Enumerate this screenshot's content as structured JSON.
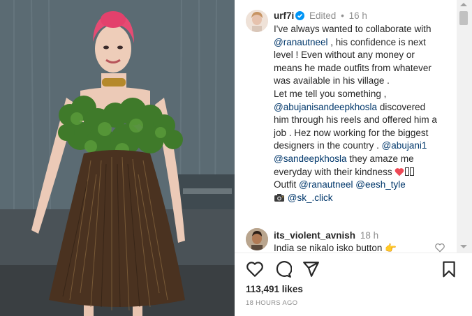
{
  "post": {
    "username": "urf7i",
    "edited_label": "Edited",
    "separator": "•",
    "time": "16 h",
    "caption_lines": [
      [
        {
          "t": "I've always wanted to collaborate with",
          "m": false
        }
      ],
      [
        {
          "t": "@ranautneel",
          "m": true
        },
        {
          "t": " , his confidence is next",
          "m": false
        }
      ],
      [
        {
          "t": "level ! Even without any money or",
          "m": false
        }
      ],
      [
        {
          "t": "means he made outfits from whatever",
          "m": false
        }
      ],
      [
        {
          "t": "was available in his village .",
          "m": false
        }
      ],
      [
        {
          "t": "Let me tell you something ,",
          "m": false
        }
      ],
      [
        {
          "t": "@abujanisandeepkhosla",
          "m": true
        },
        {
          "t": " discovered",
          "m": false
        }
      ],
      [
        {
          "t": "him through his reels and offered him a",
          "m": false
        }
      ],
      [
        {
          "t": "job . Hez now working for the biggest",
          "m": false
        }
      ],
      [
        {
          "t": "designers in the country . ",
          "m": false
        },
        {
          "t": "@abujani1",
          "m": true
        }
      ],
      [
        {
          "t": "@sandeepkhosla",
          "m": true
        },
        {
          "t": " they amaze me",
          "m": false
        }
      ],
      [
        {
          "t": "everyday with their kindness ",
          "m": false
        },
        {
          "emoji": "heart"
        },
        {
          "emoji": "box"
        },
        {
          "emoji": "box"
        }
      ],
      [
        {
          "t": "Outfit ",
          "m": false
        },
        {
          "t": "@ranautneel",
          "m": true
        },
        {
          "t": " ",
          "m": false
        },
        {
          "t": "@eesh_tyle",
          "m": true
        }
      ],
      [
        {
          "emoji": "camera"
        },
        {
          "t": " ",
          "m": false
        },
        {
          "t": "@sk_.click",
          "m": true
        }
      ]
    ]
  },
  "comment": {
    "username": "its_violent_avnish",
    "time": "18 h",
    "text": "India se nikalo isko button 👉"
  },
  "actions": {
    "like": "heart-icon",
    "comment": "comment-icon",
    "share": "share-icon",
    "save": "bookmark-icon"
  },
  "likes_text": "113,491 likes",
  "time_ago": "18 HOURS AGO",
  "colors": {
    "mention": "#00376b",
    "verified": "#0095f6",
    "heart": "#ed4956",
    "muted": "#8e8e8e"
  }
}
